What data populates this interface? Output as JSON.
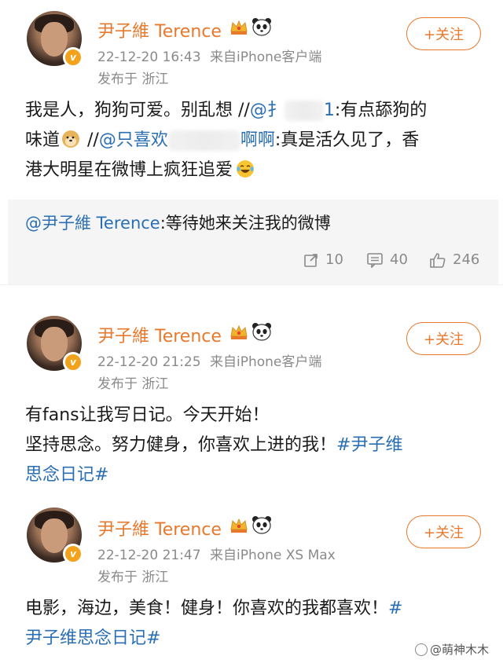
{
  "posts": [
    {
      "name": "尹子維 Terence",
      "timestamp": "22-12-20 16:43",
      "source": "来自iPhone客户端",
      "location": "发布于 浙江",
      "follow_label": "+关注",
      "text": {
        "seg1": "我是人，狗狗可爱。别乱想 //",
        "mention1": "@扌",
        "mention1_tail": "1",
        "seg2": ":有点舔狗的",
        "seg3": "味道",
        "seg4": " //",
        "mention2": "@只喜欢",
        "mention2_tail": "啊啊",
        "seg5": ":真是活久见了，香",
        "seg6": "港大明星在微博上疯狂追爱"
      },
      "repost": {
        "mention": "@尹子維 Terence",
        "text": ":等待她来关注我的微博"
      },
      "actions": {
        "share_count": "10",
        "comment_count": "40",
        "like_count": "246"
      }
    },
    {
      "name": "尹子維 Terence",
      "timestamp": "22-12-20 21:25",
      "source": "来自iPhone客户端",
      "location": "发布于 浙江",
      "follow_label": "+关注",
      "text": {
        "line1": "有fans让我写日记。今天开始！",
        "line2": "坚持思念。努力健身，你喜欢上进的我！",
        "tag": "#尹子维",
        "tag_line2": "思念日记#"
      }
    },
    {
      "name": "尹子維 Terence",
      "timestamp": "22-12-20 21:47",
      "source": "来自iPhone XS Max",
      "location": "发布于 浙江",
      "follow_label": "+关注",
      "text": {
        "line1": "电影，海边，美食！健身！你喜欢的我都喜欢！",
        "tag_start": "#",
        "tag_line2": "尹子维思念日记#"
      }
    }
  ],
  "watermark": "@萌神木木",
  "colors": {
    "name_orange": "#e8792c",
    "link_blue": "#2a6fb3",
    "meta_gray": "#8a8a8a",
    "repost_bg": "#f5f5f5"
  },
  "icons": [
    "crown-icon",
    "panda-icon",
    "verified-badge-icon",
    "repost-icon",
    "comment-icon",
    "like-icon",
    "doge-emoji-icon",
    "laugh-cry-emoji-icon"
  ]
}
